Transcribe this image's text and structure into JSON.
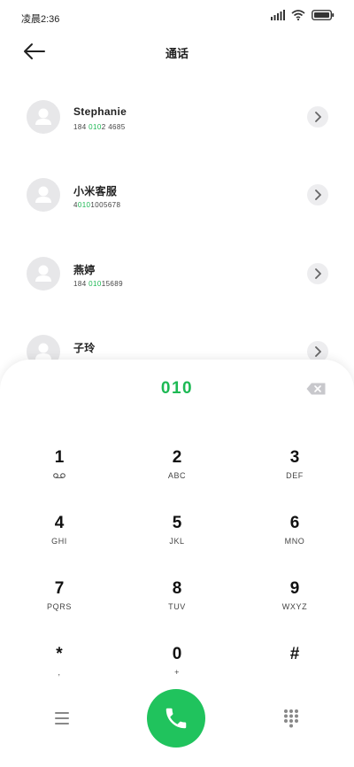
{
  "status_bar": {
    "time": "凌晨2:36"
  },
  "header": {
    "title": "通话"
  },
  "contacts": [
    {
      "name": "Stephanie",
      "number_pre": "184 ",
      "number_match": "010",
      "number_post": "2 4685"
    },
    {
      "name": "小米客服",
      "number_pre": "4",
      "number_match": "010",
      "number_post": "1005678"
    },
    {
      "name": "燕婷",
      "number_pre": "184 ",
      "number_match": "010",
      "number_post": "15689"
    },
    {
      "name": "子玲",
      "number_pre": "",
      "number_match": "",
      "number_post": ""
    }
  ],
  "dialpad": {
    "input": "010",
    "keys": [
      {
        "digit": "1",
        "letters": ""
      },
      {
        "digit": "2",
        "letters": "ABC"
      },
      {
        "digit": "3",
        "letters": "DEF"
      },
      {
        "digit": "4",
        "letters": "GHI"
      },
      {
        "digit": "5",
        "letters": "JKL"
      },
      {
        "digit": "6",
        "letters": "MNO"
      },
      {
        "digit": "7",
        "letters": "PQRS"
      },
      {
        "digit": "8",
        "letters": "TUV"
      },
      {
        "digit": "9",
        "letters": "WXYZ"
      },
      {
        "digit": "*",
        "letters": ","
      },
      {
        "digit": "0",
        "letters": "+"
      },
      {
        "digit": "#",
        "letters": ""
      }
    ]
  },
  "colors": {
    "accent": "#1db954",
    "call_button": "#20c35d",
    "avatar_bg": "#e7e7e9"
  },
  "icons": {
    "back": "back-arrow-icon",
    "chevron": "chevron-right-icon",
    "backspace": "backspace-icon",
    "call": "phone-icon",
    "menu": "menu-icon",
    "keypad": "keypad-icon",
    "voicemail": "voicemail-icon"
  }
}
